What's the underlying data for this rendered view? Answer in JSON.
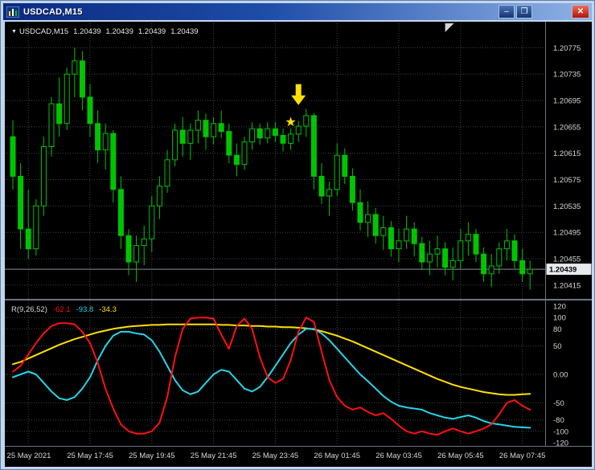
{
  "window": {
    "title": "USDCAD,M15",
    "controls": {
      "minimize": "–",
      "restore": "❐",
      "close": "✕"
    }
  },
  "chart_data": [
    {
      "type": "candlestick",
      "title": "USDCAD,M15",
      "info_label": {
        "marker": "▼",
        "symbol": "USDCAD,M15",
        "open": "1.20439",
        "high": "1.20439",
        "low": "1.20439",
        "close": "1.20439"
      },
      "y_ticks": [
        "1.20775",
        "1.20735",
        "1.20695",
        "1.20655",
        "1.20615",
        "1.20575",
        "1.20535",
        "1.20495",
        "1.20455",
        "1.20415"
      ],
      "y_range": [
        1.20405,
        1.20795
      ],
      "x_tick_labels": [
        "25 May 2021",
        "25 May 17:45",
        "25 May 19:45",
        "25 May 21:45",
        "25 May 23:45",
        "26 May 01:45",
        "26 May 03:45",
        "26 May 05:45",
        "26 May 07:45"
      ],
      "x_tick_candle_indices": [
        2,
        10,
        18,
        26,
        34,
        42,
        50,
        58,
        66
      ],
      "bid": {
        "label": "1.20439",
        "value": 1.20439
      },
      "shift_marker": {
        "candle_index": 56
      },
      "annotations": [
        {
          "type": "arrow-down",
          "candle_index": 37,
          "price": 1.20688,
          "color": "#ffe000"
        },
        {
          "type": "star",
          "glyph": "★",
          "candle_index": 36,
          "price": 1.20662,
          "color": "#ffe000"
        }
      ],
      "colors": {
        "background": "#000000",
        "grid": "#3d444d",
        "candle": "#00c400",
        "bull_fill": "#000000",
        "bid_line": "#8a9097",
        "bid_tag_bg": "#e6e9ee",
        "bid_tag_text": "#000000",
        "axis_text": "#d6d6d6",
        "separator": "#6e7480",
        "shift_marker": "#cfd4da"
      },
      "candles_ohlc": [
        [
          1.2064,
          1.20665,
          1.2056,
          1.2058
        ],
        [
          1.2058,
          1.206,
          1.2047,
          1.205
        ],
        [
          1.205,
          1.2056,
          1.20455,
          1.2047
        ],
        [
          1.2047,
          1.20545,
          1.2046,
          1.20535
        ],
        [
          1.20535,
          1.2064,
          1.2052,
          1.20625
        ],
        [
          1.20625,
          1.207,
          1.2061,
          1.2069
        ],
        [
          1.2069,
          1.2073,
          1.2064,
          1.2066
        ],
        [
          1.2066,
          1.20745,
          1.2065,
          1.20735
        ],
        [
          1.20735,
          1.20775,
          1.207,
          1.20755
        ],
        [
          1.20755,
          1.2077,
          1.2068,
          1.207
        ],
        [
          1.207,
          1.2072,
          1.2064,
          1.2066
        ],
        [
          1.2066,
          1.2068,
          1.206,
          1.2062
        ],
        [
          1.2062,
          1.2066,
          1.2059,
          1.20645
        ],
        [
          1.20645,
          1.2065,
          1.2054,
          1.2056
        ],
        [
          1.2056,
          1.2058,
          1.2047,
          1.2049
        ],
        [
          1.2049,
          1.205,
          1.2043,
          1.2045
        ],
        [
          1.2045,
          1.2049,
          1.2042,
          1.20475
        ],
        [
          1.20475,
          1.20505,
          1.20445,
          1.20485
        ],
        [
          1.20485,
          1.2055,
          1.20465,
          1.20535
        ],
        [
          1.20535,
          1.2058,
          1.20515,
          1.20565
        ],
        [
          1.20565,
          1.2062,
          1.20555,
          1.20605
        ],
        [
          1.20605,
          1.2066,
          1.20595,
          1.2065
        ],
        [
          1.2065,
          1.2067,
          1.2061,
          1.2063
        ],
        [
          1.2063,
          1.2066,
          1.20605,
          1.2065
        ],
        [
          1.2065,
          1.2068,
          1.2063,
          1.20665
        ],
        [
          1.20665,
          1.20675,
          1.2062,
          1.2064
        ],
        [
          1.2064,
          1.2067,
          1.20628,
          1.2066
        ],
        [
          1.2066,
          1.2068,
          1.20638,
          1.20648
        ],
        [
          1.20648,
          1.2066,
          1.206,
          1.20612
        ],
        [
          1.20612,
          1.2063,
          1.2058,
          1.20598
        ],
        [
          1.20598,
          1.2064,
          1.2059,
          1.20632
        ],
        [
          1.20632,
          1.20662,
          1.2062,
          1.20652
        ],
        [
          1.20652,
          1.2066,
          1.20628,
          1.20638
        ],
        [
          1.20638,
          1.20662,
          1.2063,
          1.20652
        ],
        [
          1.20652,
          1.20662,
          1.20632,
          1.20642
        ],
        [
          1.20642,
          1.20652,
          1.20618,
          1.2063
        ],
        [
          1.2063,
          1.20652,
          1.2062,
          1.20644
        ],
        [
          1.20644,
          1.20664,
          1.20632,
          1.20656
        ],
        [
          1.20656,
          1.20682,
          1.2064,
          1.20672
        ],
        [
          1.20672,
          1.20676,
          1.2056,
          1.2058
        ],
        [
          1.2058,
          1.206,
          1.20538,
          1.2055
        ],
        [
          1.2055,
          1.20572,
          1.2052,
          1.2056
        ],
        [
          1.2056,
          1.2063,
          1.2055,
          1.20612
        ],
        [
          1.20612,
          1.20622,
          1.20568,
          1.2058
        ],
        [
          1.2058,
          1.20592,
          1.20528,
          1.2054
        ],
        [
          1.2054,
          1.2056,
          1.20498,
          1.2051
        ],
        [
          1.2051,
          1.20542,
          1.20488,
          1.20522
        ],
        [
          1.20522,
          1.20532,
          1.20478,
          1.2049
        ],
        [
          1.2049,
          1.2052,
          1.20468,
          1.20502
        ],
        [
          1.20502,
          1.20512,
          1.20458,
          1.2047
        ],
        [
          1.2047,
          1.205,
          1.2045,
          1.20482
        ],
        [
          1.20482,
          1.2052,
          1.2047,
          1.205
        ],
        [
          1.205,
          1.2051,
          1.20458,
          1.20478
        ],
        [
          1.20478,
          1.20488,
          1.20438,
          1.2045
        ],
        [
          1.2045,
          1.20482,
          1.2043,
          1.20462
        ],
        [
          1.20462,
          1.2049,
          1.20442,
          1.2047
        ],
        [
          1.2047,
          1.2048,
          1.2043,
          1.20442
        ],
        [
          1.20442,
          1.20472,
          1.20422,
          1.20452
        ],
        [
          1.20452,
          1.205,
          1.2044,
          1.20482
        ],
        [
          1.20482,
          1.2051,
          1.2046,
          1.20492
        ],
        [
          1.20492,
          1.205,
          1.2045,
          1.20462
        ],
        [
          1.20462,
          1.20472,
          1.2042,
          1.20432
        ],
        [
          1.20432,
          1.20462,
          1.20412,
          1.20444
        ],
        [
          1.20444,
          1.2048,
          1.20432,
          1.2047
        ],
        [
          1.2047,
          1.205,
          1.20452,
          1.20482
        ],
        [
          1.20482,
          1.20492,
          1.2044,
          1.20452
        ],
        [
          1.20452,
          1.2047,
          1.2042,
          1.20432
        ],
        [
          1.20432,
          1.20452,
          1.20408,
          1.20439
        ]
      ]
    },
    {
      "type": "line",
      "title": "R(9,26,52)",
      "current_values": [
        "-62.1",
        "-93.8",
        "-34.3"
      ],
      "y_ticks": [
        "120",
        "100",
        "80",
        "50",
        "0.00",
        "-50",
        "-80",
        "-100",
        "-120"
      ],
      "levels": [
        100,
        80,
        50,
        0,
        -50,
        -80,
        -100
      ],
      "y_range": [
        -120,
        120
      ],
      "series": [
        {
          "name": "fast-line",
          "color": "#ff1010",
          "values": [
            5,
            15,
            35,
            55,
            72,
            85,
            90,
            90,
            88,
            75,
            55,
            20,
            -25,
            -60,
            -88,
            -100,
            -104,
            -104,
            -100,
            -85,
            -40,
            30,
            80,
            98,
            100,
            100,
            98,
            70,
            45,
            85,
            98,
            80,
            30,
            -5,
            -15,
            -8,
            25,
            75,
            100,
            92,
            40,
            -10,
            -40,
            -55,
            -62,
            -58,
            -66,
            -72,
            -68,
            -78,
            -90,
            -100,
            -104,
            -100,
            -104,
            -106,
            -100,
            -95,
            -100,
            -104,
            -100,
            -95,
            -88,
            -70,
            -50,
            -45,
            -55,
            -62.1
          ]
        },
        {
          "name": "medium-line",
          "color": "#22d6e8",
          "values": [
            -5,
            0,
            5,
            0,
            -15,
            -30,
            -42,
            -45,
            -40,
            -25,
            -5,
            25,
            50,
            68,
            75,
            75,
            72,
            70,
            60,
            40,
            15,
            -10,
            -28,
            -35,
            -30,
            -15,
            0,
            8,
            5,
            -10,
            -25,
            -30,
            -22,
            -5,
            15,
            35,
            55,
            70,
            80,
            80,
            72,
            60,
            45,
            30,
            15,
            0,
            -12,
            -25,
            -38,
            -48,
            -55,
            -58,
            -60,
            -62,
            -68,
            -72,
            -76,
            -78,
            -75,
            -72,
            -76,
            -82,
            -86,
            -88,
            -90,
            -92,
            -93,
            -93.8
          ]
        },
        {
          "name": "slow-line",
          "color": "#ffe000",
          "values": [
            18,
            22,
            28,
            34,
            40,
            46,
            52,
            57,
            62,
            66,
            70,
            74,
            77,
            80,
            82,
            84,
            85,
            86,
            87,
            87,
            88,
            88,
            88,
            88,
            88,
            88,
            88,
            87,
            87,
            86,
            86,
            85,
            85,
            84,
            84,
            83,
            83,
            82,
            81,
            79,
            76,
            72,
            68,
            63,
            58,
            52,
            46,
            40,
            34,
            28,
            22,
            16,
            10,
            4,
            -2,
            -8,
            -13,
            -18,
            -22,
            -25,
            -28,
            -31,
            -33,
            -35,
            -36,
            -36,
            -35,
            -34.3
          ]
        }
      ]
    }
  ]
}
